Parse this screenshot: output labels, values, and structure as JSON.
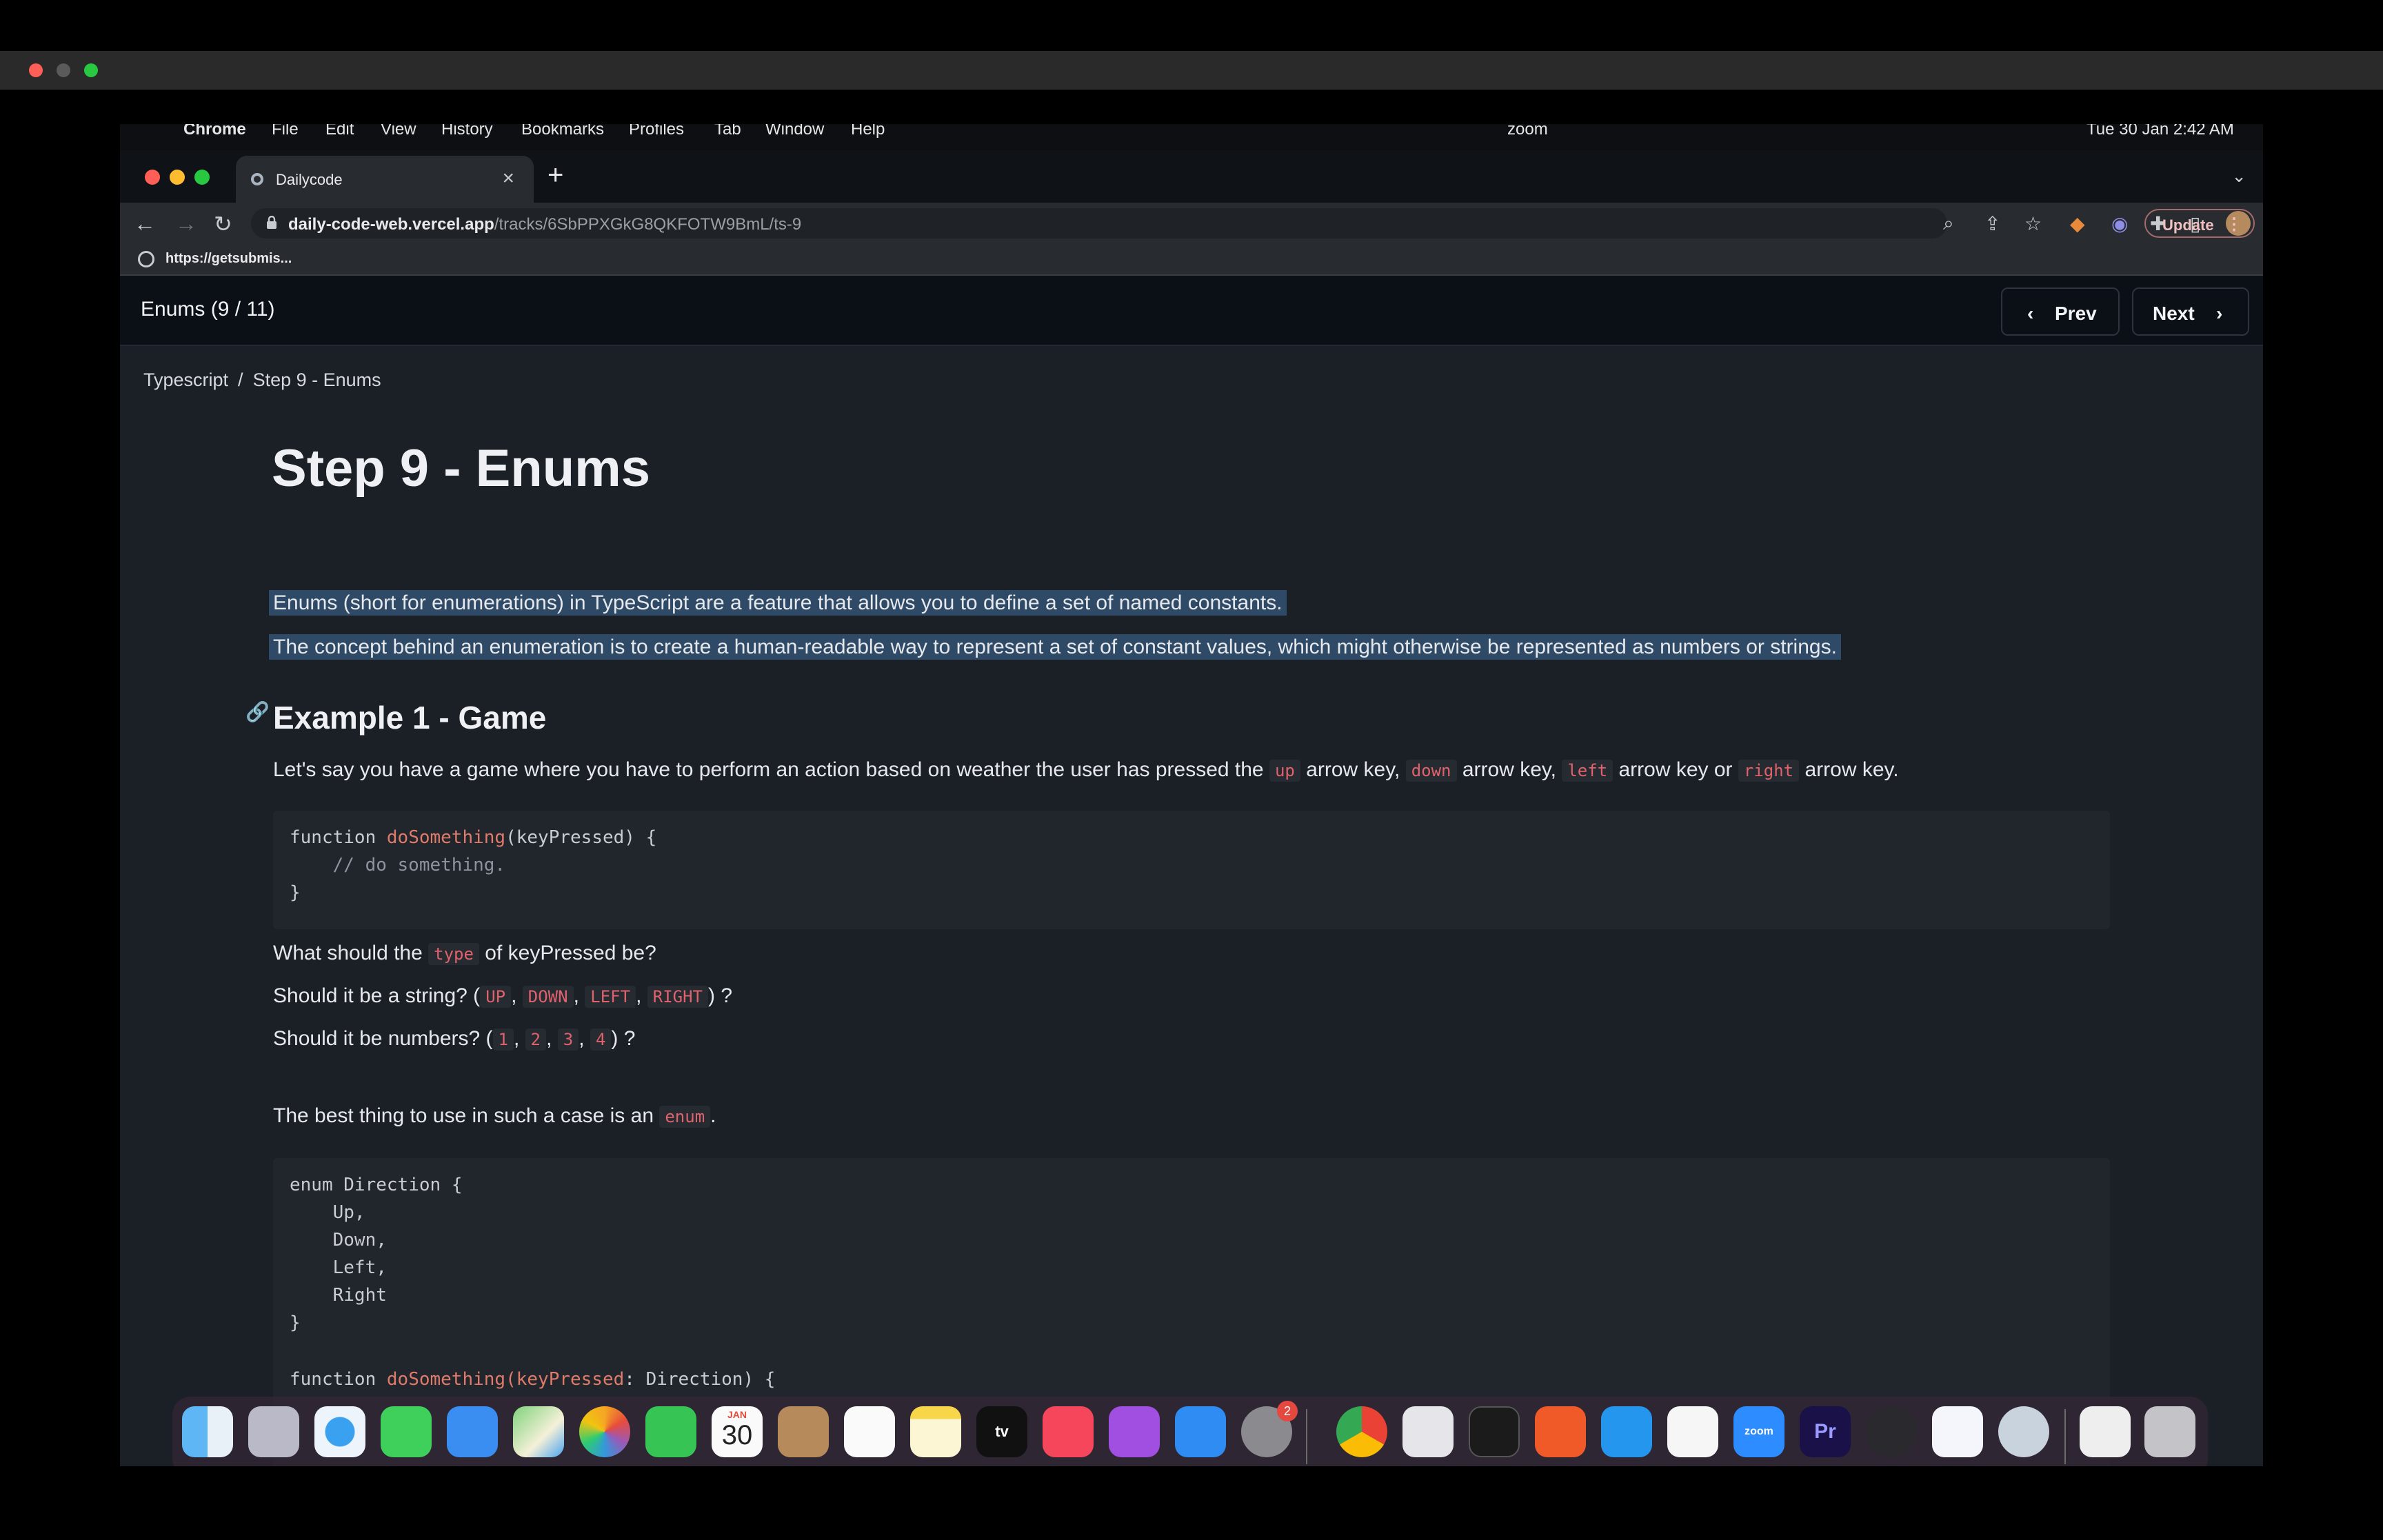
{
  "menubar": {
    "items": [
      "Chrome",
      "File",
      "Edit",
      "View",
      "History",
      "Bookmarks",
      "Profiles",
      "Tab",
      "Window",
      "Help"
    ],
    "right_items": [
      "zoom",
      "Tue 30 Jan 2:42 AM"
    ]
  },
  "browser": {
    "tab_title": "Dailycode",
    "url_host": "daily-code-web.vercel.app",
    "url_path": "/tracks/6SbPPXGkG8QKFOTW9BmL/ts-9",
    "update_label": "Update",
    "bookmark_label": "https://getsubmis..."
  },
  "page": {
    "appbar_title": "Enums (9 / 11)",
    "prev_label": "Prev",
    "next_label": "Next",
    "breadcrumb": {
      "root": "Typescript",
      "separator": "/",
      "current": "Step 9 - Enums"
    },
    "title": "Step 9 - Enums",
    "intro_1": "Enums (short for enumerations) in TypeScript are a feature that allows you to define a set of named constants.",
    "intro_2": "The concept behind an enumeration is to create a human-readable way to represent a set of constant values, which might otherwise be represented as numbers or strings.",
    "example_heading": "Example 1 - Game",
    "example_text": {
      "pre": "Let's say you have a game where you have to perform an action based on weather the user has pressed the",
      "up": "up",
      "t1": "arrow key,",
      "down": "down",
      "t2": "arrow key,",
      "left": "left",
      "t3": "arrow key or",
      "right": "right",
      "t4": "arrow key."
    },
    "code1": {
      "l1_kw": "function ",
      "l1_fn": "doSomething",
      "l1_rest": "(keyPressed) {",
      "l2": "    // do something.",
      "l3": "}"
    },
    "q1": {
      "pre": "What should the",
      "code": "type",
      "post": "of keyPressed be?"
    },
    "q2": {
      "pre": "Should it be a string? (",
      "c1": "UP",
      "c2": "DOWN",
      "c3": "LEFT",
      "c4": "RIGHT",
      "post": ") ?",
      "comma": ","
    },
    "q3": {
      "pre": "Should it be numbers? (",
      "c1": "1",
      "c2": "2",
      "c3": "3",
      "c4": "4",
      "post": ") ?",
      "comma": ","
    },
    "best": {
      "pre": "The best thing to use in such a case is an",
      "code": "enum",
      "post": "."
    },
    "code2": {
      "l1_kw": "enum ",
      "l1_rest": "Direction {",
      "l2": "    Up,",
      "l3": "    Down,",
      "l4": "    Left,",
      "l5": "    Right",
      "l6": "}",
      "l8_kw": "function ",
      "l8_fn": "doSomething",
      "l8_fn2": "(keyPressed",
      "l8_rest": ": Direction) {"
    }
  },
  "dock": {
    "calendar_month": "JAN",
    "calendar_day": "30",
    "settings_badge": "2",
    "appletv_label": "tv",
    "zoom_label": "zoom",
    "premiere_label": "Pr"
  },
  "colors": {
    "page_bg": "#1b1f26",
    "appbar_bg": "#0b0f16",
    "selection": "#2e4a66",
    "inline_code": "#e0626c"
  }
}
